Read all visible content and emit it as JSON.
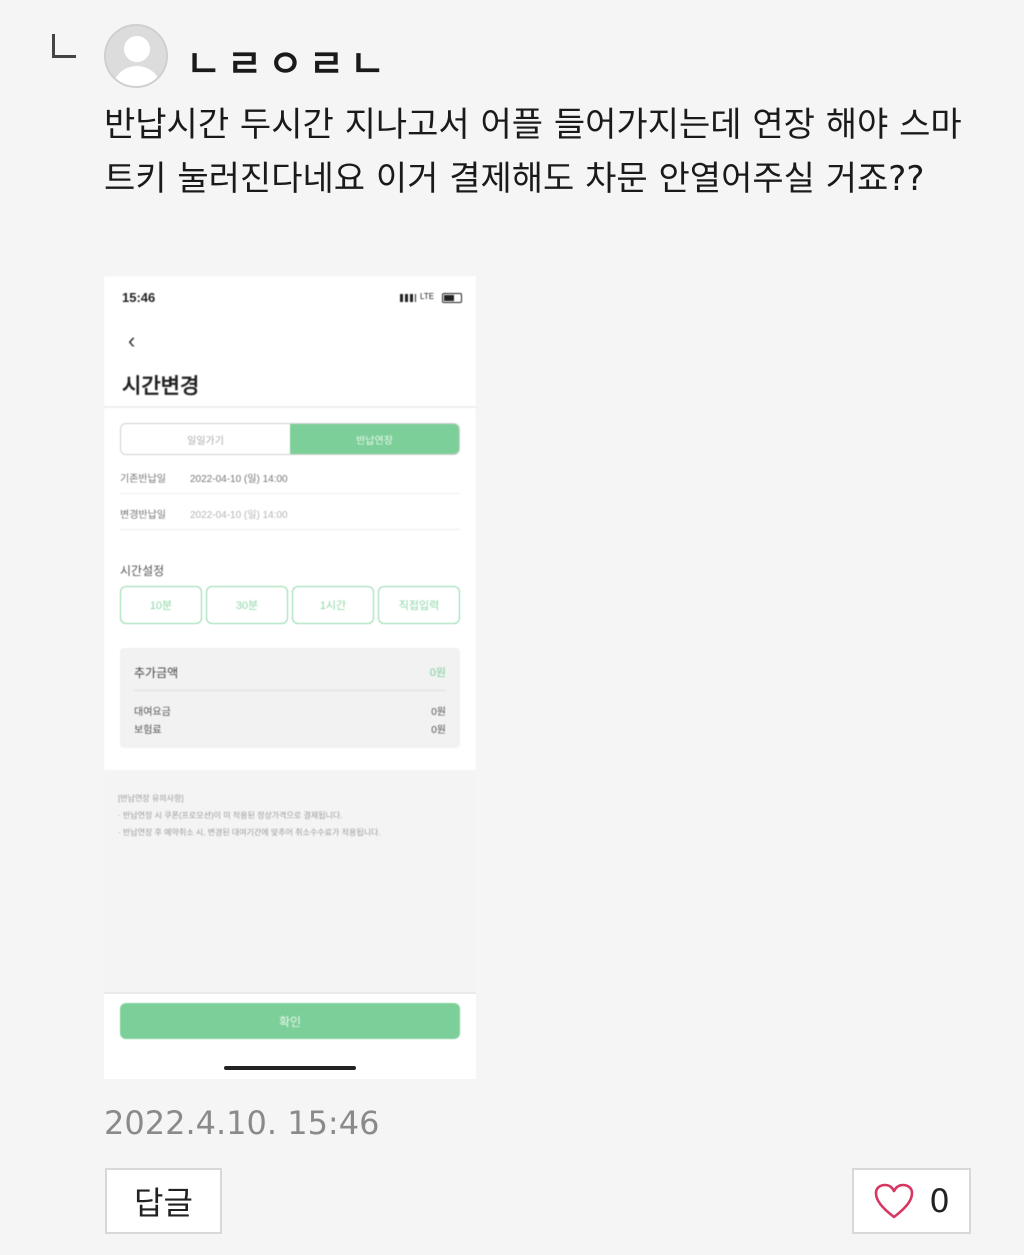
{
  "comment": {
    "nickname": "ㄴㄹㅇㄹㄴ",
    "text": "반납시간 두시간 지나고서 어플 들어가지는데 연장 해야 스마트키 눌러진다네요 이거 결제해도 차문 안열어주실 거죠??",
    "timestamp": "2022.4.10. 15:46",
    "reply_label": "답글",
    "like_count": "0",
    "icons": {
      "avatar": "default-user-avatar",
      "like": "heart-icon",
      "reply_mark": "reply-indent-icon"
    },
    "colors": {
      "heart": "#d6365f",
      "accent_green": "#7ccf98"
    }
  },
  "screenshot": {
    "status_time": "15:46",
    "status_network": "LTE",
    "back_icon": "chevron-left-icon",
    "title": "시간변경",
    "segments": [
      "일일가기",
      "반납연장"
    ],
    "selected_segment": "반납연장",
    "rows": [
      {
        "label": "기존반납일",
        "value": "2022-04-10 (일) 14:00"
      },
      {
        "label": "변경반납일",
        "value": "2022-04-10 (일) 14:00"
      }
    ],
    "time_section_label": "시간설정",
    "time_buttons": [
      "10분",
      "30분",
      "1시간",
      "직접입력"
    ],
    "fee": {
      "header": "추가금액",
      "header_value": "0원",
      "items": [
        {
          "label": "대여요금",
          "value": "0원"
        },
        {
          "label": "보험료",
          "value": "0원"
        }
      ]
    },
    "notes": [
      "[반납연장 유의사항]",
      "· 반납연장 시 쿠폰(프로모션)이 미 적용된 정상가격으로 결제됩니다.",
      "· 반납연장 후 예약취소 시, 변경된 대여기간에 맞추어 취소수수료가 적용됩니다."
    ],
    "confirm_label": "확인"
  }
}
